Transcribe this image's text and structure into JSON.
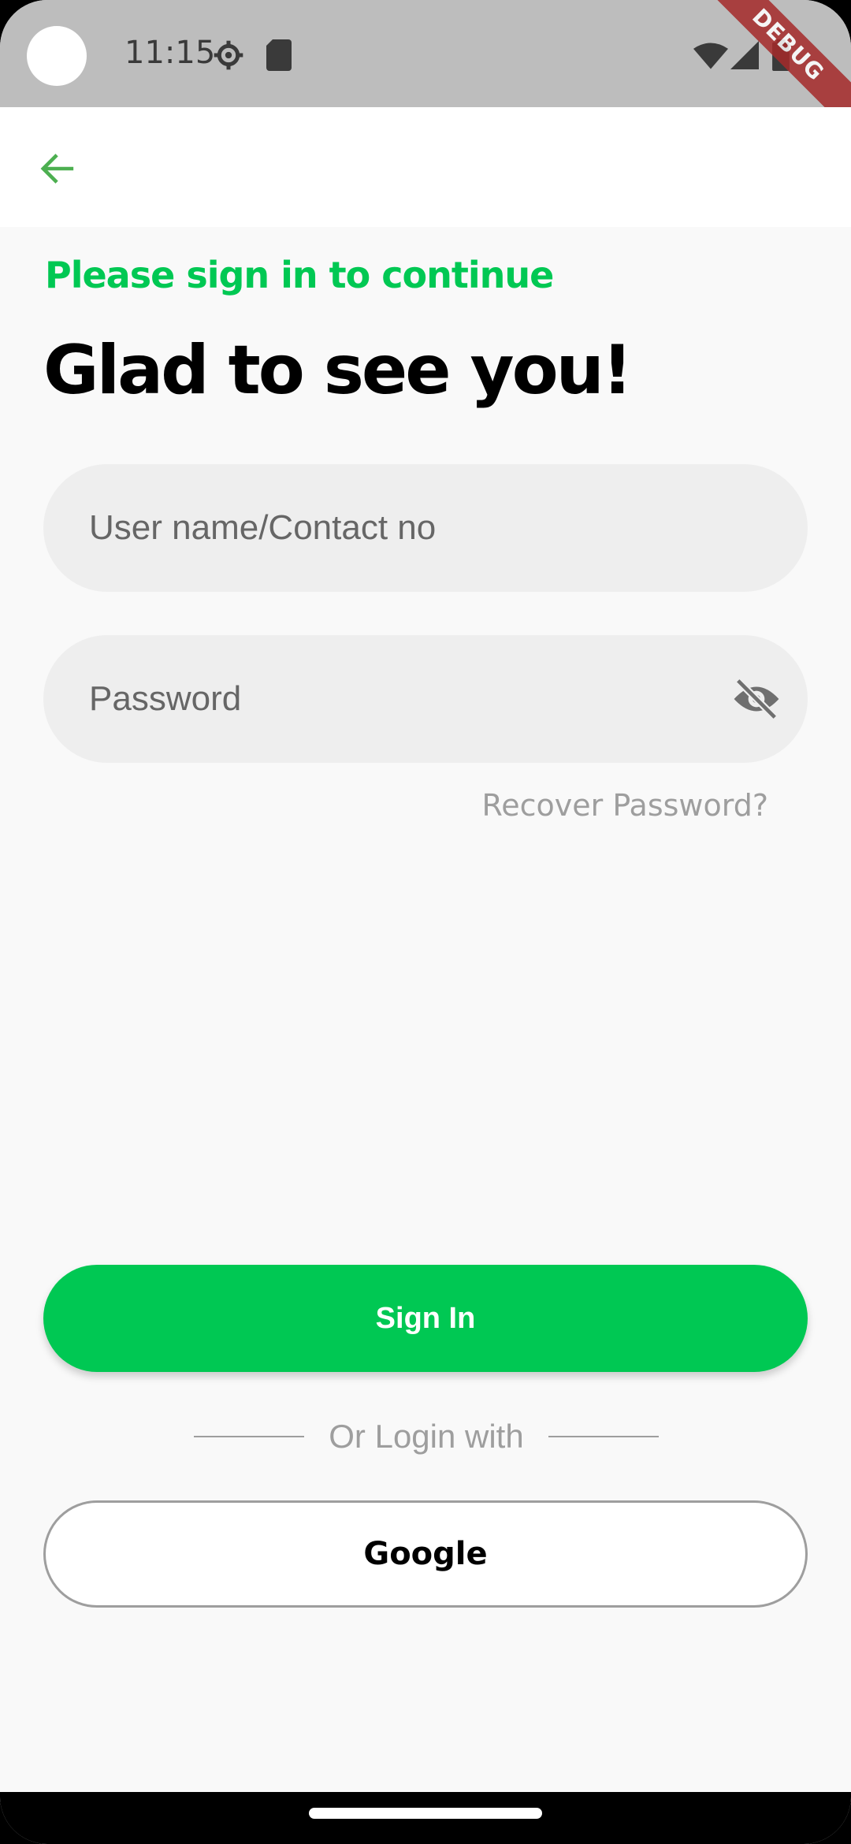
{
  "status_bar": {
    "time": "11:15",
    "debug_label": "DEBUG"
  },
  "header": {
    "subtitle": "Please sign in to continue",
    "title": "Glad to see you!"
  },
  "form": {
    "username_placeholder": "User name/Contact no",
    "password_placeholder": "Password",
    "recover_label": "Recover Password?"
  },
  "actions": {
    "sign_in_label": "Sign In",
    "divider_label": "Or Login with",
    "google_label": "Google"
  },
  "colors": {
    "accent": "#00c853",
    "back_arrow": "#4caf50"
  }
}
